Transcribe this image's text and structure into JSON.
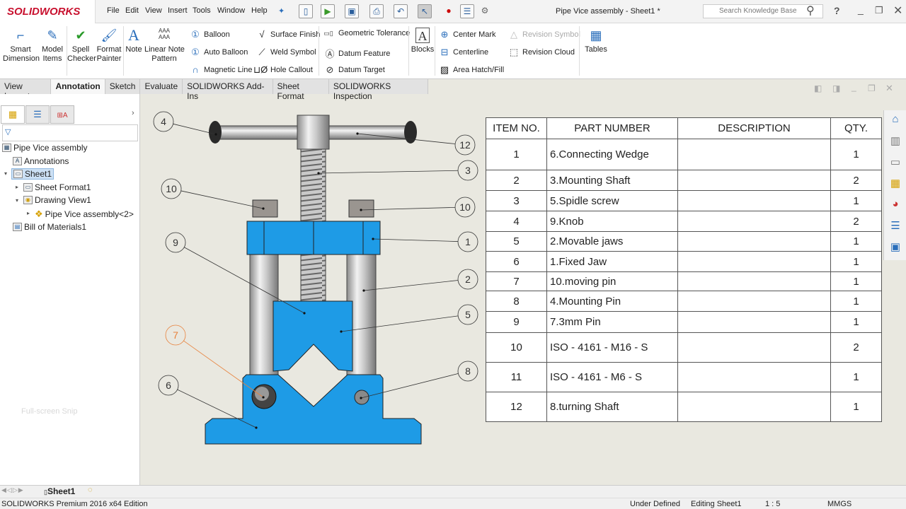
{
  "app": {
    "brand": "SOLIDWORKS",
    "title": "Pipe Vice assembly - Sheet1 *",
    "search_placeholder": "Search Knowledge Base"
  },
  "menu": [
    "File",
    "Edit",
    "View",
    "Insert",
    "Tools",
    "Window",
    "Help"
  ],
  "ribbon": {
    "big": [
      {
        "label": "Smart\nDimension",
        "icon": "smart-dimension-icon"
      },
      {
        "label": "Model\nItems",
        "icon": "model-items-icon"
      },
      {
        "label": "Spell\nChecker",
        "icon": "spell-checker-icon"
      },
      {
        "label": "Format\nPainter",
        "icon": "format-painter-icon"
      },
      {
        "label": "Note",
        "icon": "note-icon"
      },
      {
        "label": "Linear Note\nPattern",
        "icon": "linear-note-pattern-icon"
      },
      {
        "label": "Blocks",
        "icon": "blocks-icon"
      },
      {
        "label": "Tables",
        "icon": "tables-icon"
      }
    ],
    "small": [
      "Balloon",
      "Auto Balloon",
      "Magnetic Line",
      "Surface Finish",
      "Weld Symbol",
      "Hole Callout",
      "Geometric Tolerance",
      "Datum Feature",
      "Datum Target",
      "Center Mark",
      "Centerline",
      "Area Hatch/Fill",
      "Revision Symbol",
      "Revision Cloud"
    ]
  },
  "tabs": [
    "View Layout",
    "Annotation",
    "Sketch",
    "Evaluate",
    "SOLIDWORKS Add-Ins",
    "Sheet Format",
    "SOLIDWORKS Inspection"
  ],
  "active_tab": "Annotation",
  "tree": [
    "Pipe Vice assembly",
    "Annotations",
    "Sheet1",
    "Sheet Format1",
    "Drawing View1",
    "Pipe Vice assembly<2>",
    "Bill of Materials1"
  ],
  "canvas": {
    "ghost_text": "Full-screen Snip"
  },
  "balloons": [
    "4",
    "12",
    "3",
    "10",
    "10",
    "1",
    "9",
    "2",
    "5",
    "7",
    "8",
    "6"
  ],
  "bom": {
    "headers": [
      "ITEM NO.",
      "PART NUMBER",
      "DESCRIPTION",
      "QTY."
    ],
    "rows": [
      [
        "1",
        "6.Connecting Wedge",
        "",
        "1"
      ],
      [
        "2",
        "3.Mounting Shaft",
        "",
        "2"
      ],
      [
        "3",
        "5.Spidle screw",
        "",
        "1"
      ],
      [
        "4",
        "9.Knob",
        "",
        "2"
      ],
      [
        "5",
        "2.Movable jaws",
        "",
        "1"
      ],
      [
        "6",
        "1.Fixed Jaw",
        "",
        "1"
      ],
      [
        "7",
        "10.moving pin",
        "",
        "1"
      ],
      [
        "8",
        "4.Mounting Pin",
        "",
        "1"
      ],
      [
        "9",
        "7.3mm Pin",
        "",
        "1"
      ],
      [
        "10",
        "ISO - 4161 - M16 - S",
        "",
        "2"
      ],
      [
        "11",
        "ISO - 4161 - M6 - S",
        "",
        "1"
      ],
      [
        "12",
        "8.turning Shaft",
        "",
        "1"
      ]
    ]
  },
  "sheet_tab": "Sheet1",
  "status": {
    "edition": "SOLIDWORKS Premium 2016 x64 Edition",
    "state": "Under Defined",
    "editing": "Editing Sheet1",
    "scale": "1 : 5",
    "units": "MMGS"
  },
  "colors": {
    "part_blue": "#1e9be6",
    "brand_red": "#c8102e",
    "highlight_balloon": "#e8803a"
  }
}
